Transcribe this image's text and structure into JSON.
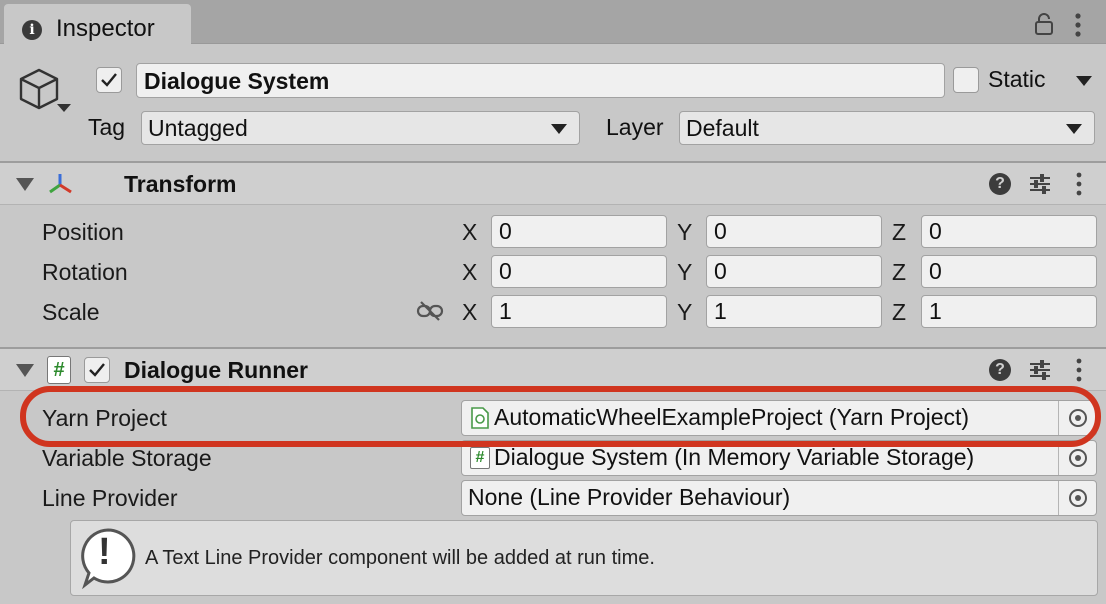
{
  "tab": {
    "title": "Inspector",
    "info_icon": "i"
  },
  "object": {
    "name": "Dialogue System",
    "active": true,
    "static_label": "Static",
    "static_checked": false,
    "tag_label": "Tag",
    "tag_value": "Untagged",
    "layer_label": "Layer",
    "layer_value": "Default"
  },
  "transform": {
    "title": "Transform",
    "rows": [
      {
        "label": "Position",
        "x": "0",
        "y": "0",
        "z": "0"
      },
      {
        "label": "Rotation",
        "x": "0",
        "y": "0",
        "z": "0"
      },
      {
        "label": "Scale",
        "x": "1",
        "y": "1",
        "z": "1"
      }
    ],
    "axes": [
      "X",
      "Y",
      "Z"
    ]
  },
  "dialogue_runner": {
    "title": "Dialogue Runner",
    "enabled": true,
    "script_icon_glyph": "#",
    "help_glyph": "?",
    "fields": [
      {
        "label": "Yarn Project",
        "value": "AutomaticWheelExampleProject (Yarn Project)",
        "icon": "yarn-project-asset-icon"
      },
      {
        "label": "Variable Storage",
        "value": "Dialogue System (In Memory Variable Storage)",
        "icon": "script-icon",
        "icon_glyph": "#"
      },
      {
        "label": "Line Provider",
        "value": "None (Line Provider Behaviour)",
        "icon": ""
      }
    ],
    "helpbox": {
      "text": "A Text Line Provider component will be added at run time.",
      "icon": "warning-icon",
      "glyph": "!"
    }
  },
  "colors": {
    "highlight": "#d0351f",
    "background": "#c8c8c8",
    "tabstrip": "#a5a5a5",
    "script_icon": "#2e8b2e"
  }
}
